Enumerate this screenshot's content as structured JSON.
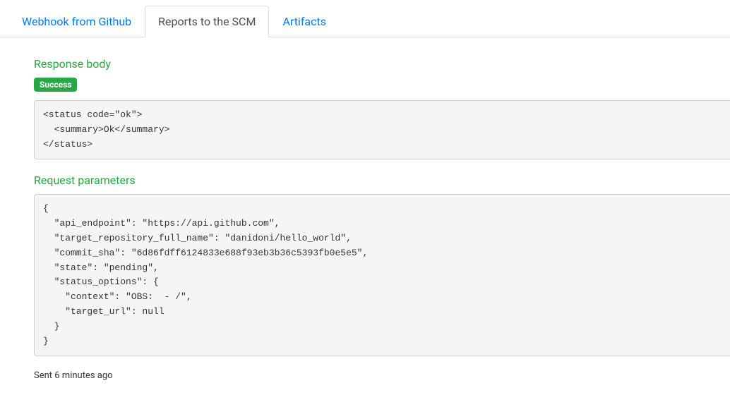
{
  "tabs": {
    "webhook": "Webhook from Github",
    "reports": "Reports to the SCM",
    "artifacts": "Artifacts"
  },
  "response": {
    "heading": "Response body",
    "badge": "Success",
    "body": "<status code=\"ok\">\n  <summary>Ok</summary>\n</status>"
  },
  "request": {
    "heading": "Request parameters",
    "body": "{\n  \"api_endpoint\": \"https://api.github.com\",\n  \"target_repository_full_name\": \"danidoni/hello_world\",\n  \"commit_sha\": \"6d86fdff6124833e688f93eb3b36c5393fb0e5e5\",\n  \"state\": \"pending\",\n  \"status_options\": {\n    \"context\": \"OBS:  - /\",\n    \"target_url\": null\n  }\n}"
  },
  "footer": {
    "sent": "Sent 6 minutes ago"
  }
}
